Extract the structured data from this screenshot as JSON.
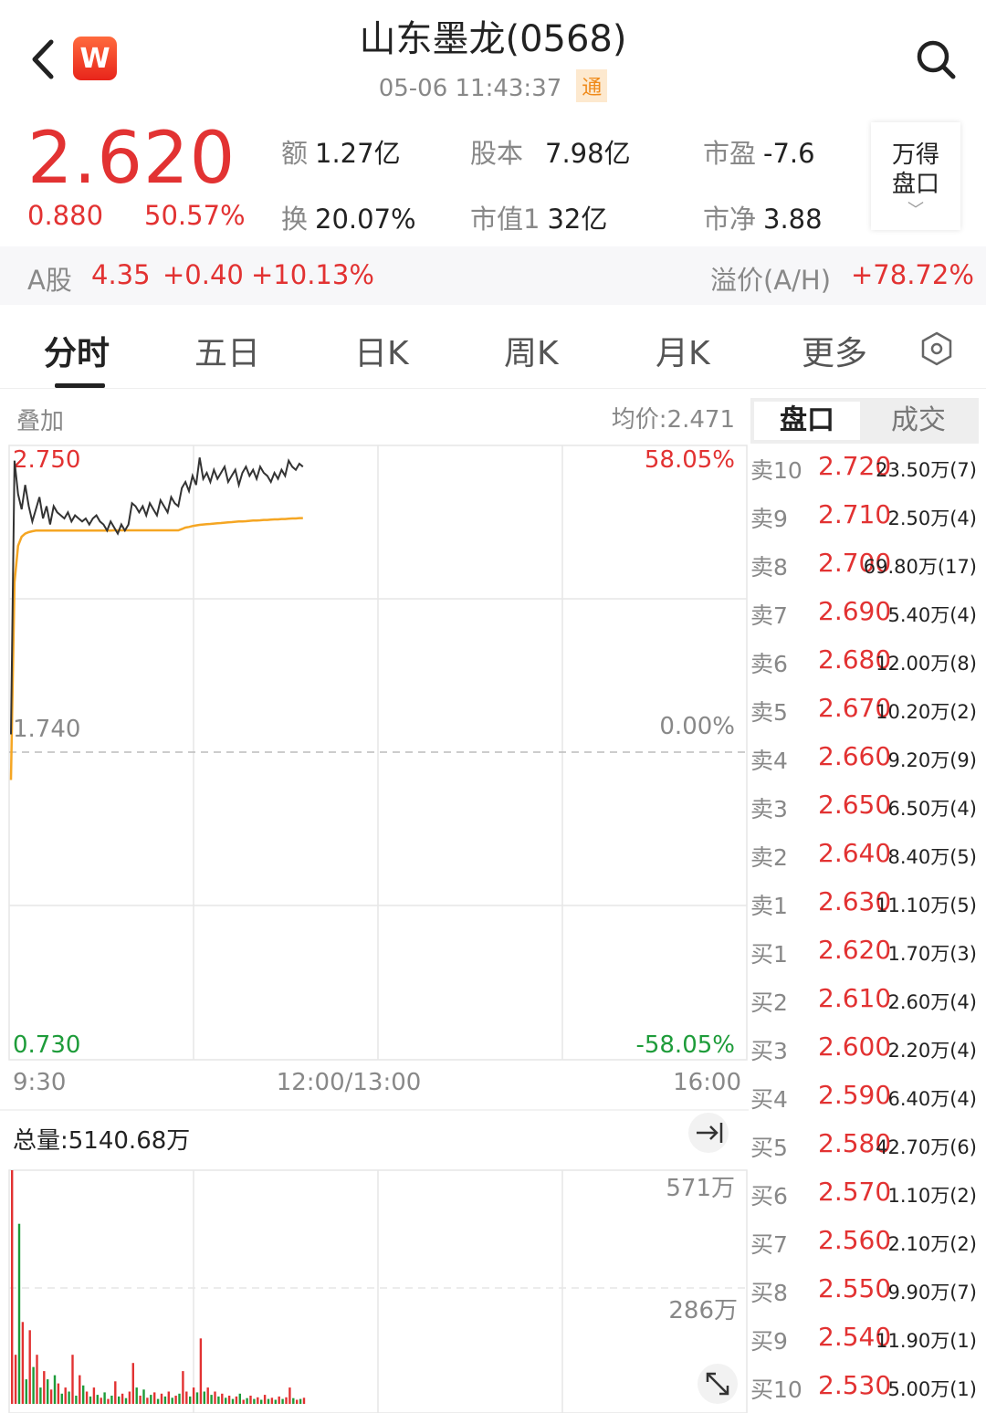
{
  "header": {
    "title": "山东墨龙(0568)",
    "datetime": "05-06 11:43:37",
    "badge": "通",
    "logo_letter": "W"
  },
  "quote": {
    "price": "2.620",
    "change": "0.880",
    "change_pct": "50.57%",
    "amount_label": "额",
    "amount": "1.27亿",
    "turnover_label": "换",
    "turnover": "20.07%",
    "share_cap_label": "股本",
    "share_cap": "7.98亿",
    "mkt_cap_label": "市值1",
    "mkt_cap": "32亿",
    "pe_label": "市盈",
    "pe": "-7.6",
    "pb_label": "市净",
    "pb": "3.88",
    "wande_btn": "万得\n盘口"
  },
  "ashare": {
    "label": "A股",
    "price": "4.35",
    "change": "+0.40",
    "change_pct": "+10.13%",
    "premium_label": "溢价(A/H)",
    "premium": "+78.72%"
  },
  "tabs": [
    "分时",
    "五日",
    "日K",
    "周K",
    "月K",
    "更多"
  ],
  "chart": {
    "overlay_label": "叠加",
    "avg_price_label": "均价:2.471",
    "y_top": "2.750",
    "y_mid": "1.740",
    "y_bot": "0.730",
    "pct_top": "58.05%",
    "pct_mid": "0.00%",
    "pct_bot": "-58.05%",
    "x_start": "9:30",
    "x_mid": "12:00/13:00",
    "x_end": "16:00",
    "volume_label": "总量:5140.68万",
    "vol_top": "571万",
    "vol_mid": "286万",
    "colors": {
      "price_line": "#333333",
      "avg_line": "#f5a623",
      "up": "#e23232",
      "down": "#1e9c3a"
    }
  },
  "chart_data": {
    "type": "line",
    "ylim": [
      0.73,
      2.75
    ],
    "prev_close": 1.74,
    "price_series": [
      1.8,
      2.7,
      2.59,
      2.54,
      2.62,
      2.55,
      2.5,
      2.54,
      2.58,
      2.51,
      2.55,
      2.49,
      2.55,
      2.53,
      2.52,
      2.51,
      2.53,
      2.5,
      2.52,
      2.51,
      2.5,
      2.51,
      2.49,
      2.51,
      2.52,
      2.5,
      2.49,
      2.47,
      2.5,
      2.48,
      2.46,
      2.49,
      2.47,
      2.49,
      2.56,
      2.55,
      2.53,
      2.55,
      2.52,
      2.56,
      2.54,
      2.52,
      2.57,
      2.55,
      2.53,
      2.58,
      2.56,
      2.55,
      2.61,
      2.63,
      2.6,
      2.65,
      2.62,
      2.71,
      2.64,
      2.66,
      2.63,
      2.67,
      2.64,
      2.66,
      2.68,
      2.63,
      2.65,
      2.67,
      2.62,
      2.66,
      2.68,
      2.65,
      2.67,
      2.64,
      2.68,
      2.66,
      2.65,
      2.63,
      2.66,
      2.64,
      2.67,
      2.65,
      2.7,
      2.68,
      2.67,
      2.69,
      2.68
    ],
    "avg_series": [
      1.65,
      2.3,
      2.42,
      2.45,
      2.46,
      2.465,
      2.468,
      2.47,
      2.47,
      2.47,
      2.47,
      2.47,
      2.47,
      2.47,
      2.47,
      2.47,
      2.47,
      2.47,
      2.47,
      2.47,
      2.47,
      2.47,
      2.47,
      2.47,
      2.47,
      2.47,
      2.47,
      2.47,
      2.47,
      2.471,
      2.471,
      2.471,
      2.471,
      2.471,
      2.471,
      2.471,
      2.471,
      2.471,
      2.471,
      2.471,
      2.471,
      2.471,
      2.471,
      2.471,
      2.471,
      2.471,
      2.471,
      2.471,
      2.475,
      2.48,
      2.482,
      2.485,
      2.487,
      2.489,
      2.49,
      2.491,
      2.492,
      2.493,
      2.494,
      2.495,
      2.496,
      2.497,
      2.498,
      2.499,
      2.5,
      2.5,
      2.501,
      2.502,
      2.503,
      2.503,
      2.504,
      2.505,
      2.505,
      2.506,
      2.507,
      2.507,
      2.508,
      2.508,
      2.509,
      2.51,
      2.51,
      2.511,
      2.511
    ],
    "volume_max": 571,
    "volumes": [
      571,
      120,
      440,
      200,
      60,
      180,
      90,
      120,
      40,
      80,
      60,
      35,
      70,
      50,
      25,
      40,
      30,
      120,
      20,
      70,
      45,
      30,
      18,
      40,
      22,
      15,
      28,
      12,
      20,
      55,
      18,
      25,
      14,
      30,
      100,
      40,
      20,
      35,
      15,
      22,
      28,
      12,
      25,
      18,
      30,
      15,
      20,
      25,
      80,
      30,
      18,
      40,
      28,
      160,
      30,
      40,
      22,
      30,
      18,
      25,
      15,
      20,
      12,
      18,
      25,
      10,
      14,
      20,
      12,
      16,
      10,
      22,
      12,
      15,
      10,
      18,
      12,
      16,
      40,
      14,
      10,
      12,
      15
    ],
    "volume_dir": [
      "u",
      "u",
      "d",
      "u",
      "d",
      "u",
      "d",
      "u",
      "d",
      "u",
      "d",
      "u",
      "d",
      "u",
      "d",
      "u",
      "d",
      "u",
      "d",
      "u",
      "d",
      "u",
      "d",
      "u",
      "d",
      "u",
      "d",
      "u",
      "d",
      "u",
      "d",
      "u",
      "d",
      "u",
      "u",
      "d",
      "u",
      "d",
      "u",
      "d",
      "u",
      "d",
      "u",
      "d",
      "u",
      "d",
      "u",
      "d",
      "u",
      "u",
      "d",
      "u",
      "d",
      "u",
      "d",
      "u",
      "d",
      "u",
      "d",
      "u",
      "d",
      "u",
      "d",
      "u",
      "d",
      "u",
      "d",
      "u",
      "d",
      "u",
      "d",
      "u",
      "d",
      "u",
      "d",
      "u",
      "d",
      "u",
      "u",
      "d",
      "u",
      "d",
      "u"
    ]
  },
  "orderbook": {
    "tabs": [
      "盘口",
      "成交"
    ],
    "rows": [
      {
        "label": "卖10",
        "price": "2.720",
        "vol": "23.50万(7)"
      },
      {
        "label": "卖9",
        "price": "2.710",
        "vol": "2.50万(4)"
      },
      {
        "label": "卖8",
        "price": "2.700",
        "vol": "69.80万(17)"
      },
      {
        "label": "卖7",
        "price": "2.690",
        "vol": "5.40万(4)"
      },
      {
        "label": "卖6",
        "price": "2.680",
        "vol": "12.00万(8)"
      },
      {
        "label": "卖5",
        "price": "2.670",
        "vol": "10.20万(2)"
      },
      {
        "label": "卖4",
        "price": "2.660",
        "vol": "9.20万(9)"
      },
      {
        "label": "卖3",
        "price": "2.650",
        "vol": "6.50万(4)"
      },
      {
        "label": "卖2",
        "price": "2.640",
        "vol": "8.40万(5)"
      },
      {
        "label": "卖1",
        "price": "2.630",
        "vol": "11.10万(5)"
      },
      {
        "label": "买1",
        "price": "2.620",
        "vol": "1.70万(3)"
      },
      {
        "label": "买2",
        "price": "2.610",
        "vol": "2.60万(4)"
      },
      {
        "label": "买3",
        "price": "2.600",
        "vol": "2.20万(4)"
      },
      {
        "label": "买4",
        "price": "2.590",
        "vol": "6.40万(4)"
      },
      {
        "label": "买5",
        "price": "2.580",
        "vol": "42.70万(6)"
      },
      {
        "label": "买6",
        "price": "2.570",
        "vol": "1.10万(2)"
      },
      {
        "label": "买7",
        "price": "2.560",
        "vol": "2.10万(2)"
      },
      {
        "label": "买8",
        "price": "2.550",
        "vol": "9.90万(7)"
      },
      {
        "label": "买9",
        "price": "2.540",
        "vol": "11.90万(1)"
      },
      {
        "label": "买10",
        "price": "2.530",
        "vol": "5.00万(1)"
      }
    ]
  }
}
